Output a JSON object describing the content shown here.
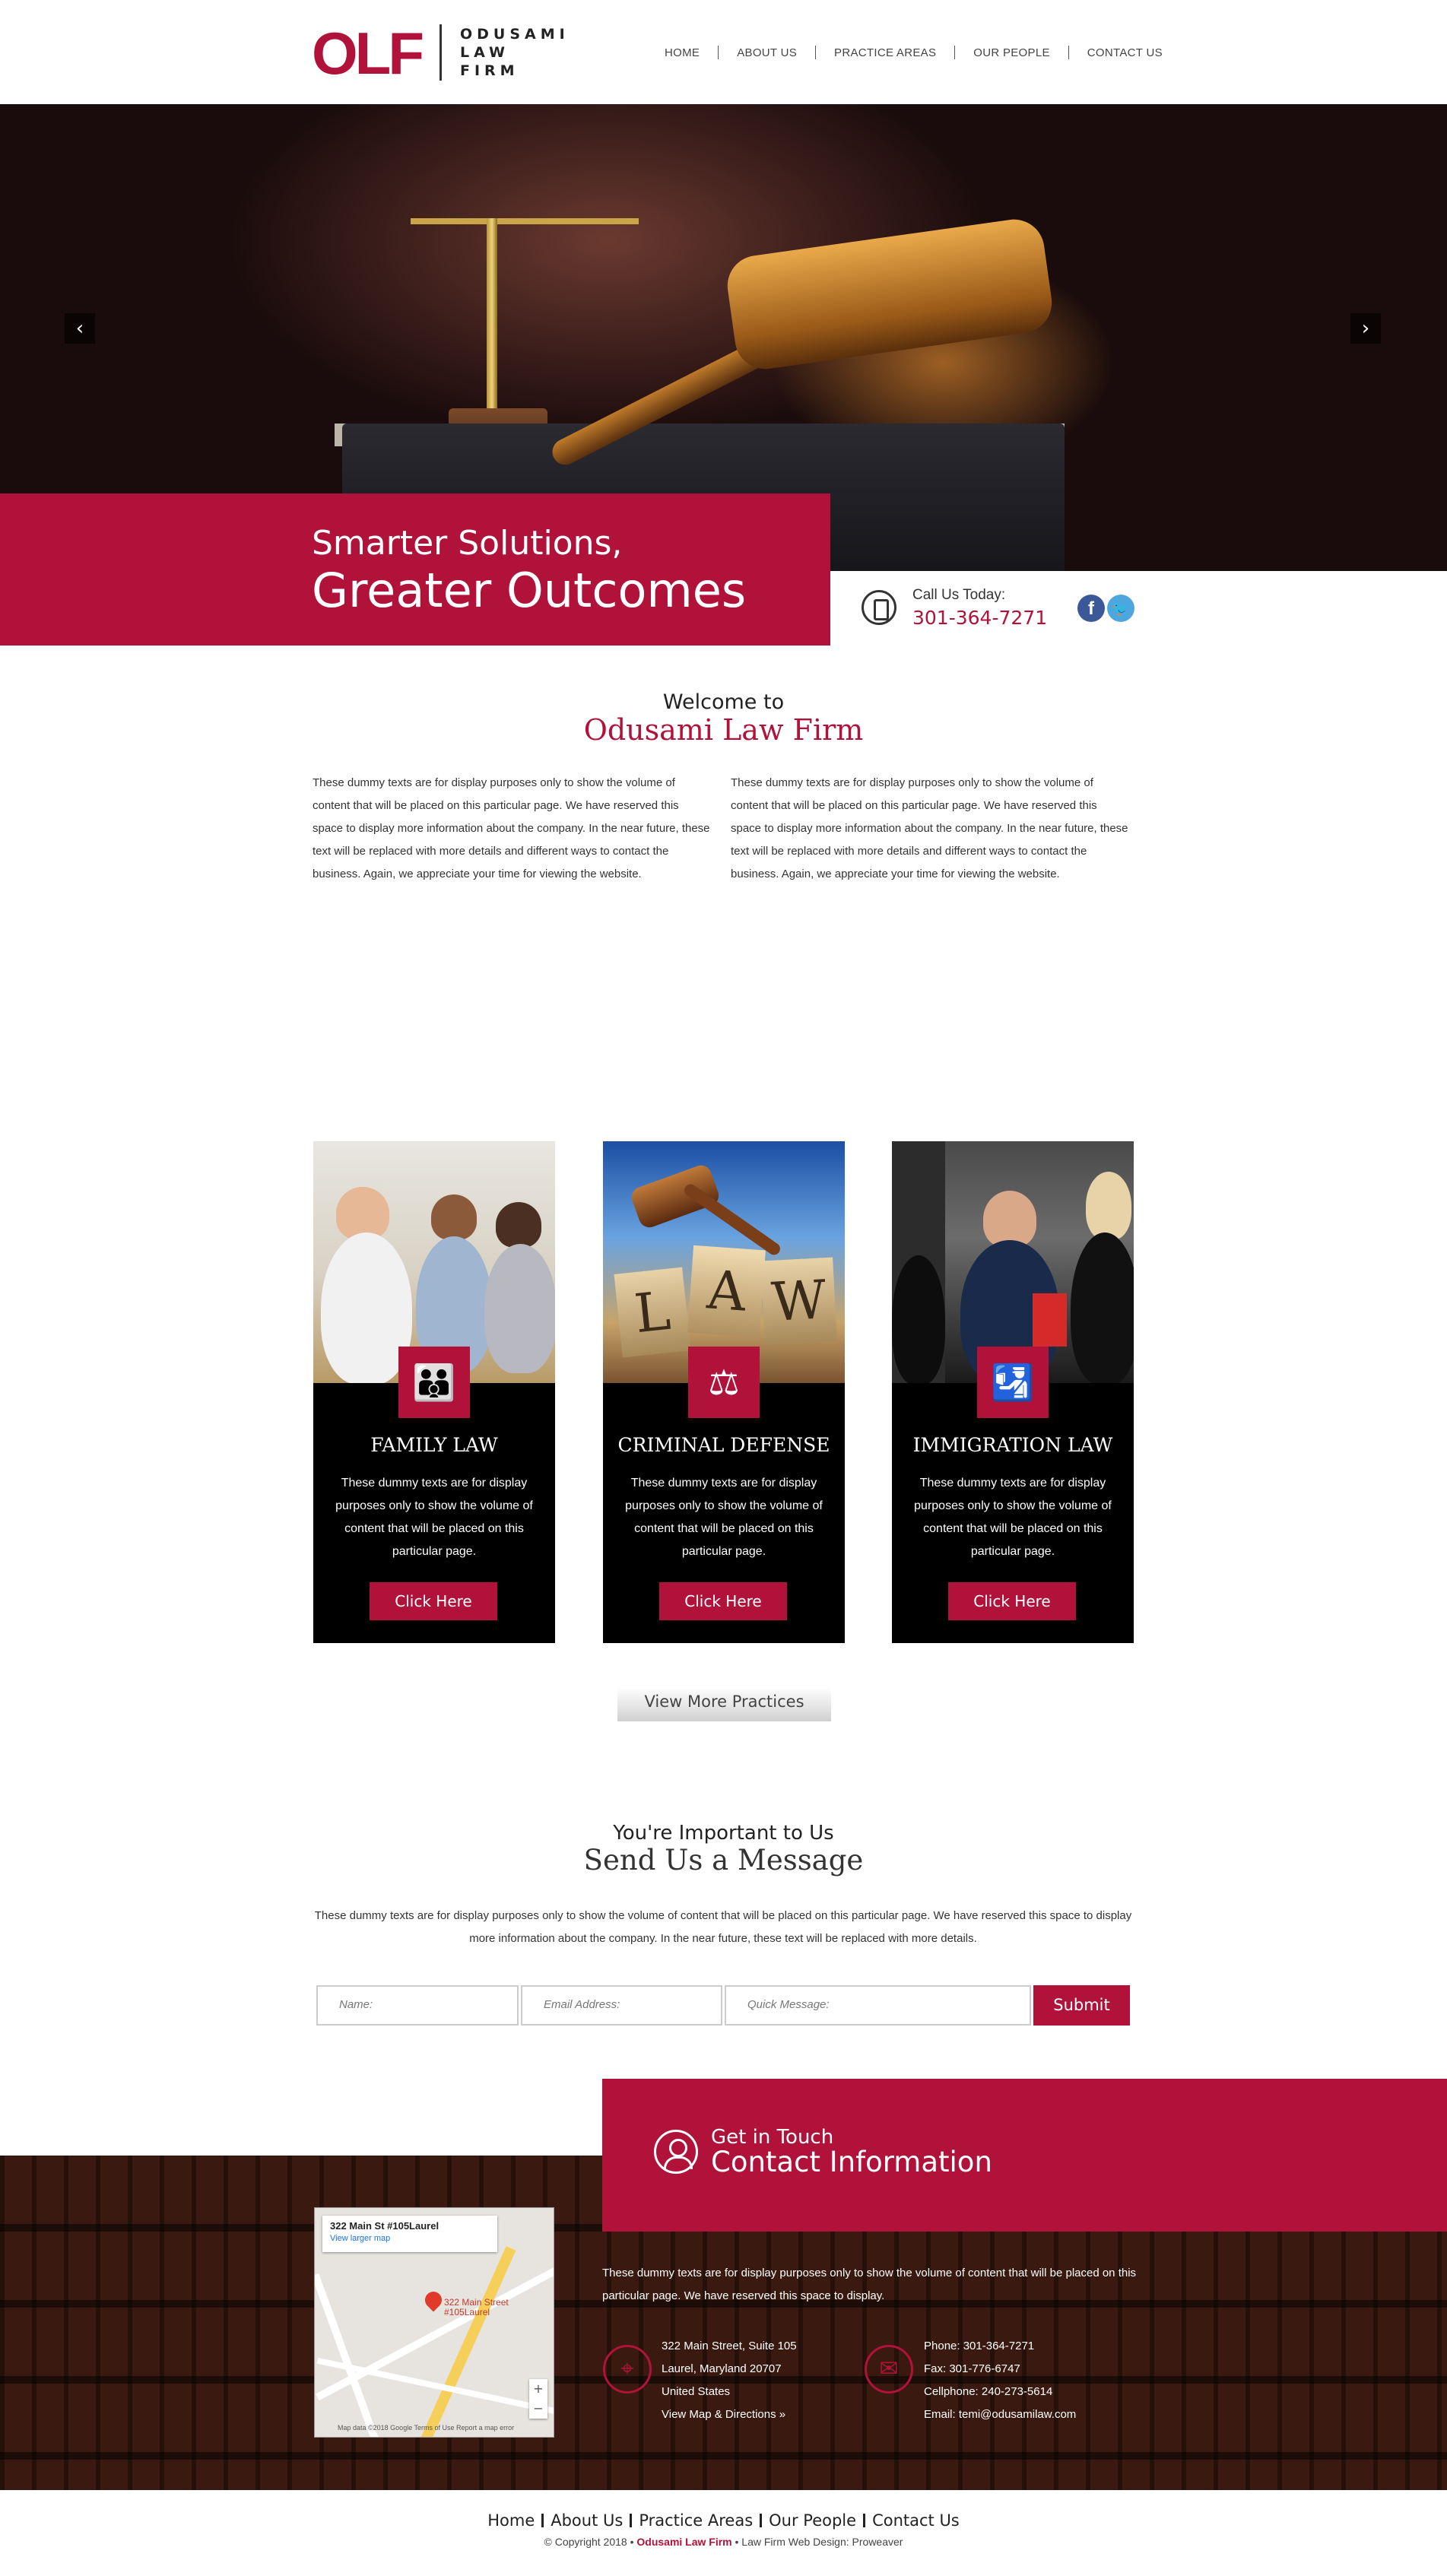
{
  "header": {
    "logo_mark": "OLF",
    "logo_lines": [
      "ODUSAMI",
      "LAW",
      "FIRM"
    ],
    "nav": [
      "HOME",
      "ABOUT US",
      "PRACTICE AREAS",
      "OUR PEOPLE",
      "CONTACT US"
    ]
  },
  "hero": {
    "prev_icon": "‹",
    "next_icon": "›",
    "tagline_1": "Smarter Solutions,",
    "tagline_2": "Greater Outcomes",
    "call_label": "Call Us Today:",
    "call_phone": "301-364-7271",
    "social": [
      "facebook-icon",
      "twitter-icon"
    ]
  },
  "welcome": {
    "line_1": "Welcome to",
    "line_2": "Odusami Law Firm",
    "para_1": "These dummy texts are for display purposes only to show the volume of content that will be placed on this particular page. We have reserved this space to display more information about the company. In the near future, these text will be replaced with more details and different ways to contact the business. Again, we appreciate your time for viewing the website.",
    "para_2": "These dummy texts are for display purposes only to show the volume of content that will be placed on this particular page. We have reserved this space to display more information about the company. In the near future, these text will be replaced with more details and different ways to contact the business. Again, we appreciate your time for viewing the website."
  },
  "practices": [
    {
      "title": "FAMILY LAW",
      "icon": "family-icon",
      "text": "These dummy texts are for display purposes only to show the volume of content that will be placed on this particular page.",
      "button": "Click Here"
    },
    {
      "title": "CRIMINAL DEFENSE",
      "icon": "scales-icon",
      "text": "These dummy texts are for display purposes only to show the volume of content that will be placed on this particular page.",
      "button": "Click Here"
    },
    {
      "title": "IMMIGRATION LAW",
      "icon": "passport-icon",
      "text": "These dummy texts are for display purposes only to show the volume of content that will be placed on this particular page.",
      "button": "Click Here"
    }
  ],
  "criminal_image_letters": [
    "L",
    "A",
    "W"
  ],
  "more_button": "View More Practices",
  "message": {
    "line_1": "You're Important to Us",
    "line_2": "Send Us a Message",
    "para": "These dummy texts are for display purposes only to show the volume of content that will be placed on this particular page. We have reserved this space to display more information about the company. In the near future, these text will be replaced with more details.",
    "name_placeholder": "Name:",
    "email_placeholder": "Email Address:",
    "msg_placeholder": "Quick Message:",
    "submit": "Submit"
  },
  "contact": {
    "line_1": "Get in Touch",
    "line_2": "Contact Information",
    "para": "These dummy texts are for display purposes only to show the volume of content that will be placed on this particular page. We have reserved this space to display.",
    "address": [
      "322 Main Street, Suite 105",
      "Laurel, Maryland 20707",
      "United States",
      "View Map & Directions »"
    ],
    "phones": [
      "Phone: 301-364-7271",
      "Fax: 301-776-6747",
      "Cellphone: 240-273-5614",
      "Email: temi@odusamilaw.com"
    ],
    "map": {
      "address": "322 Main St #105Laurel",
      "link": "View larger map",
      "pin_label_1": "322 Main Street",
      "pin_label_2": "#105Laurel",
      "footer": "Map data ©2018 Google   Terms of Use   Report a map error"
    }
  },
  "footer": {
    "nav": [
      "Home",
      "About Us",
      "Practice Areas",
      "Our People",
      "Contact Us"
    ],
    "copyright_pre": "© Copyright 2018 •",
    "brand": "Odusami Law Firm",
    "copyright_post": "• Law Firm Web Design: Proweaver"
  },
  "colors": {
    "accent": "#b0123a",
    "dark": "#000000"
  }
}
